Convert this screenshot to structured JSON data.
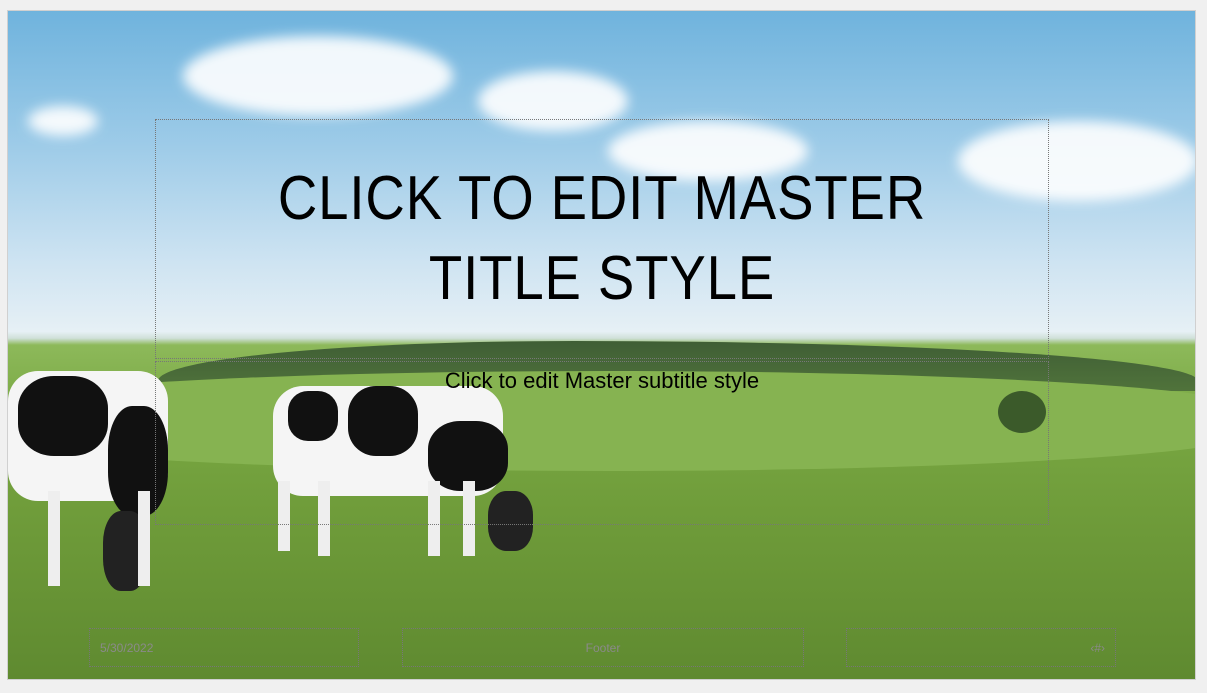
{
  "slide": {
    "title": "CLICK TO EDIT MASTER TITLE STYLE",
    "subtitle": "Click to edit Master subtitle style",
    "date": "5/30/2022",
    "footer": "Footer",
    "slide_number": "‹#›"
  },
  "colors": {
    "sky": "#6fb3dd",
    "grass": "#79a843"
  }
}
